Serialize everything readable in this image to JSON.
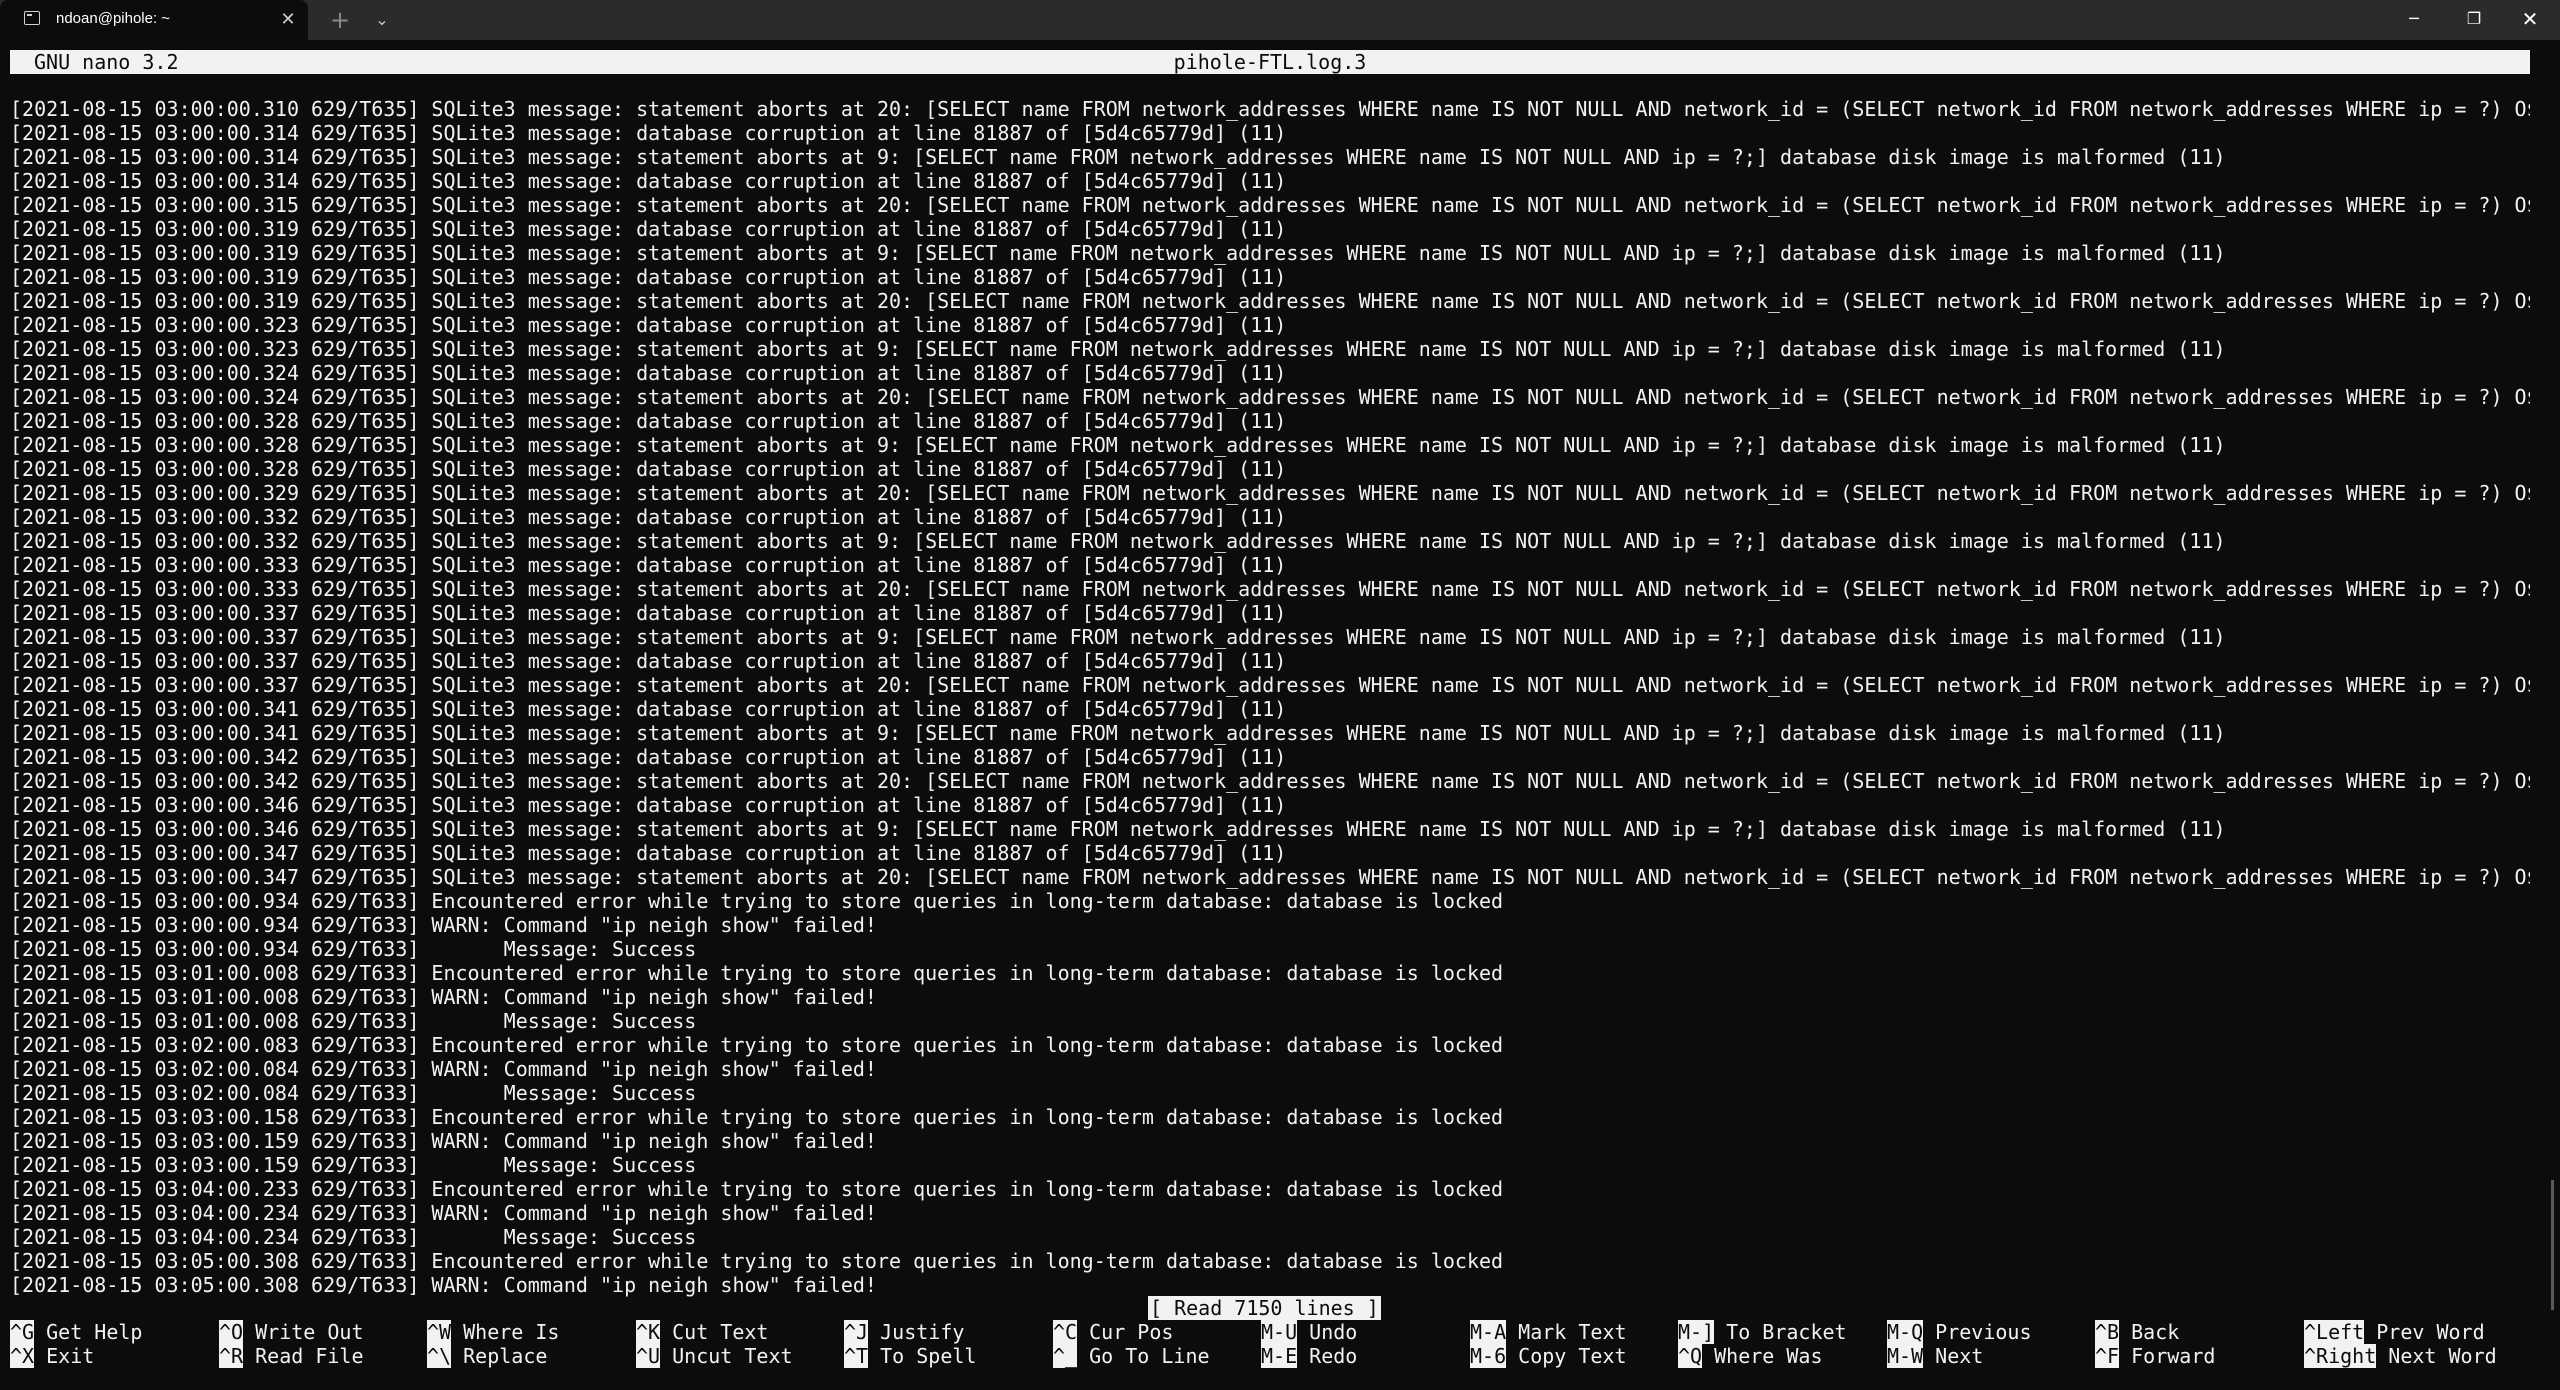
{
  "window": {
    "tab_title": "ndoan@pihole: ~",
    "tab_close": "✕",
    "new_tab": "+",
    "tab_dropdown": "⌄",
    "minimize": "─",
    "maximize": "❐",
    "close": "✕"
  },
  "nano": {
    "version": "GNU nano 3.2",
    "filename": "pihole-FTL.log.3",
    "status": "[ Read 7150 lines ]"
  },
  "log_lines": [
    "[2021-08-15 03:00:00.310 629/T635] SQLite3 message: statement aborts at 20: [SELECT name FROM network_addresses WHERE name IS NOT NULL AND network_id = (SELECT network_id FROM network_addresses WHERE ip = ?) O$",
    "[2021-08-15 03:00:00.314 629/T635] SQLite3 message: database corruption at line 81887 of [5d4c65779d] (11)",
    "[2021-08-15 03:00:00.314 629/T635] SQLite3 message: statement aborts at 9: [SELECT name FROM network_addresses WHERE name IS NOT NULL AND ip = ?;] database disk image is malformed (11)",
    "[2021-08-15 03:00:00.314 629/T635] SQLite3 message: database corruption at line 81887 of [5d4c65779d] (11)",
    "[2021-08-15 03:00:00.315 629/T635] SQLite3 message: statement aborts at 20: [SELECT name FROM network_addresses WHERE name IS NOT NULL AND network_id = (SELECT network_id FROM network_addresses WHERE ip = ?) O$",
    "[2021-08-15 03:00:00.319 629/T635] SQLite3 message: database corruption at line 81887 of [5d4c65779d] (11)",
    "[2021-08-15 03:00:00.319 629/T635] SQLite3 message: statement aborts at 9: [SELECT name FROM network_addresses WHERE name IS NOT NULL AND ip = ?;] database disk image is malformed (11)",
    "[2021-08-15 03:00:00.319 629/T635] SQLite3 message: database corruption at line 81887 of [5d4c65779d] (11)",
    "[2021-08-15 03:00:00.319 629/T635] SQLite3 message: statement aborts at 20: [SELECT name FROM network_addresses WHERE name IS NOT NULL AND network_id = (SELECT network_id FROM network_addresses WHERE ip = ?) O$",
    "[2021-08-15 03:00:00.323 629/T635] SQLite3 message: database corruption at line 81887 of [5d4c65779d] (11)",
    "[2021-08-15 03:00:00.323 629/T635] SQLite3 message: statement aborts at 9: [SELECT name FROM network_addresses WHERE name IS NOT NULL AND ip = ?;] database disk image is malformed (11)",
    "[2021-08-15 03:00:00.324 629/T635] SQLite3 message: database corruption at line 81887 of [5d4c65779d] (11)",
    "[2021-08-15 03:00:00.324 629/T635] SQLite3 message: statement aborts at 20: [SELECT name FROM network_addresses WHERE name IS NOT NULL AND network_id = (SELECT network_id FROM network_addresses WHERE ip = ?) O$",
    "[2021-08-15 03:00:00.328 629/T635] SQLite3 message: database corruption at line 81887 of [5d4c65779d] (11)",
    "[2021-08-15 03:00:00.328 629/T635] SQLite3 message: statement aborts at 9: [SELECT name FROM network_addresses WHERE name IS NOT NULL AND ip = ?;] database disk image is malformed (11)",
    "[2021-08-15 03:00:00.328 629/T635] SQLite3 message: database corruption at line 81887 of [5d4c65779d] (11)",
    "[2021-08-15 03:00:00.329 629/T635] SQLite3 message: statement aborts at 20: [SELECT name FROM network_addresses WHERE name IS NOT NULL AND network_id = (SELECT network_id FROM network_addresses WHERE ip = ?) O$",
    "[2021-08-15 03:00:00.332 629/T635] SQLite3 message: database corruption at line 81887 of [5d4c65779d] (11)",
    "[2021-08-15 03:00:00.332 629/T635] SQLite3 message: statement aborts at 9: [SELECT name FROM network_addresses WHERE name IS NOT NULL AND ip = ?;] database disk image is malformed (11)",
    "[2021-08-15 03:00:00.333 629/T635] SQLite3 message: database corruption at line 81887 of [5d4c65779d] (11)",
    "[2021-08-15 03:00:00.333 629/T635] SQLite3 message: statement aborts at 20: [SELECT name FROM network_addresses WHERE name IS NOT NULL AND network_id = (SELECT network_id FROM network_addresses WHERE ip = ?) O$",
    "[2021-08-15 03:00:00.337 629/T635] SQLite3 message: database corruption at line 81887 of [5d4c65779d] (11)",
    "[2021-08-15 03:00:00.337 629/T635] SQLite3 message: statement aborts at 9: [SELECT name FROM network_addresses WHERE name IS NOT NULL AND ip = ?;] database disk image is malformed (11)",
    "[2021-08-15 03:00:00.337 629/T635] SQLite3 message: database corruption at line 81887 of [5d4c65779d] (11)",
    "[2021-08-15 03:00:00.337 629/T635] SQLite3 message: statement aborts at 20: [SELECT name FROM network_addresses WHERE name IS NOT NULL AND network_id = (SELECT network_id FROM network_addresses WHERE ip = ?) O$",
    "[2021-08-15 03:00:00.341 629/T635] SQLite3 message: database corruption at line 81887 of [5d4c65779d] (11)",
    "[2021-08-15 03:00:00.341 629/T635] SQLite3 message: statement aborts at 9: [SELECT name FROM network_addresses WHERE name IS NOT NULL AND ip = ?;] database disk image is malformed (11)",
    "[2021-08-15 03:00:00.342 629/T635] SQLite3 message: database corruption at line 81887 of [5d4c65779d] (11)",
    "[2021-08-15 03:00:00.342 629/T635] SQLite3 message: statement aborts at 20: [SELECT name FROM network_addresses WHERE name IS NOT NULL AND network_id = (SELECT network_id FROM network_addresses WHERE ip = ?) O$",
    "[2021-08-15 03:00:00.346 629/T635] SQLite3 message: database corruption at line 81887 of [5d4c65779d] (11)",
    "[2021-08-15 03:00:00.346 629/T635] SQLite3 message: statement aborts at 9: [SELECT name FROM network_addresses WHERE name IS NOT NULL AND ip = ?;] database disk image is malformed (11)",
    "[2021-08-15 03:00:00.347 629/T635] SQLite3 message: database corruption at line 81887 of [5d4c65779d] (11)",
    "[2021-08-15 03:00:00.347 629/T635] SQLite3 message: statement aborts at 20: [SELECT name FROM network_addresses WHERE name IS NOT NULL AND network_id = (SELECT network_id FROM network_addresses WHERE ip = ?) O$",
    "[2021-08-15 03:00:00.934 629/T633] Encountered error while trying to store queries in long-term database: database is locked",
    "[2021-08-15 03:00:00.934 629/T633] WARN: Command \"ip neigh show\" failed!",
    "[2021-08-15 03:00:00.934 629/T633]       Message: Success",
    "[2021-08-15 03:01:00.008 629/T633] Encountered error while trying to store queries in long-term database: database is locked",
    "[2021-08-15 03:01:00.008 629/T633] WARN: Command \"ip neigh show\" failed!",
    "[2021-08-15 03:01:00.008 629/T633]       Message: Success",
    "[2021-08-15 03:02:00.083 629/T633] Encountered error while trying to store queries in long-term database: database is locked",
    "[2021-08-15 03:02:00.084 629/T633] WARN: Command \"ip neigh show\" failed!",
    "[2021-08-15 03:02:00.084 629/T633]       Message: Success",
    "[2021-08-15 03:03:00.158 629/T633] Encountered error while trying to store queries in long-term database: database is locked",
    "[2021-08-15 03:03:00.159 629/T633] WARN: Command \"ip neigh show\" failed!",
    "[2021-08-15 03:03:00.159 629/T633]       Message: Success",
    "[2021-08-15 03:04:00.233 629/T633] Encountered error while trying to store queries in long-term database: database is locked",
    "[2021-08-15 03:04:00.234 629/T633] WARN: Command \"ip neigh show\" failed!",
    "[2021-08-15 03:04:00.234 629/T633]       Message: Success",
    "[2021-08-15 03:05:00.308 629/T633] Encountered error while trying to store queries in long-term database: database is locked",
    "[2021-08-15 03:05:00.308 629/T633] WARN: Command \"ip neigh show\" failed!"
  ],
  "shortcuts": [
    {
      "key": "^G",
      "label": "Get Help"
    },
    {
      "key": "^X",
      "label": "Exit"
    },
    {
      "key": "^O",
      "label": "Write Out"
    },
    {
      "key": "^R",
      "label": "Read File"
    },
    {
      "key": "^W",
      "label": "Where Is"
    },
    {
      "key": "^\\",
      "label": "Replace"
    },
    {
      "key": "^K",
      "label": "Cut Text"
    },
    {
      "key": "^U",
      "label": "Uncut Text"
    },
    {
      "key": "^J",
      "label": "Justify"
    },
    {
      "key": "^T",
      "label": "To Spell"
    },
    {
      "key": "^C",
      "label": "Cur Pos"
    },
    {
      "key": "^_",
      "label": "Go To Line"
    },
    {
      "key": "M-U",
      "label": "Undo"
    },
    {
      "key": "M-E",
      "label": "Redo"
    },
    {
      "key": "M-A",
      "label": "Mark Text"
    },
    {
      "key": "M-6",
      "label": "Copy Text"
    },
    {
      "key": "M-]",
      "label": "To Bracket"
    },
    {
      "key": "^Q",
      "label": "Where Was"
    },
    {
      "key": "M-Q",
      "label": "Previous"
    },
    {
      "key": "M-W",
      "label": "Next"
    },
    {
      "key": "^B",
      "label": "Back"
    },
    {
      "key": "^F",
      "label": "Forward"
    },
    {
      "key": "^Left",
      "label": "Prev Word"
    },
    {
      "key": "^Right",
      "label": "Next Word"
    }
  ]
}
